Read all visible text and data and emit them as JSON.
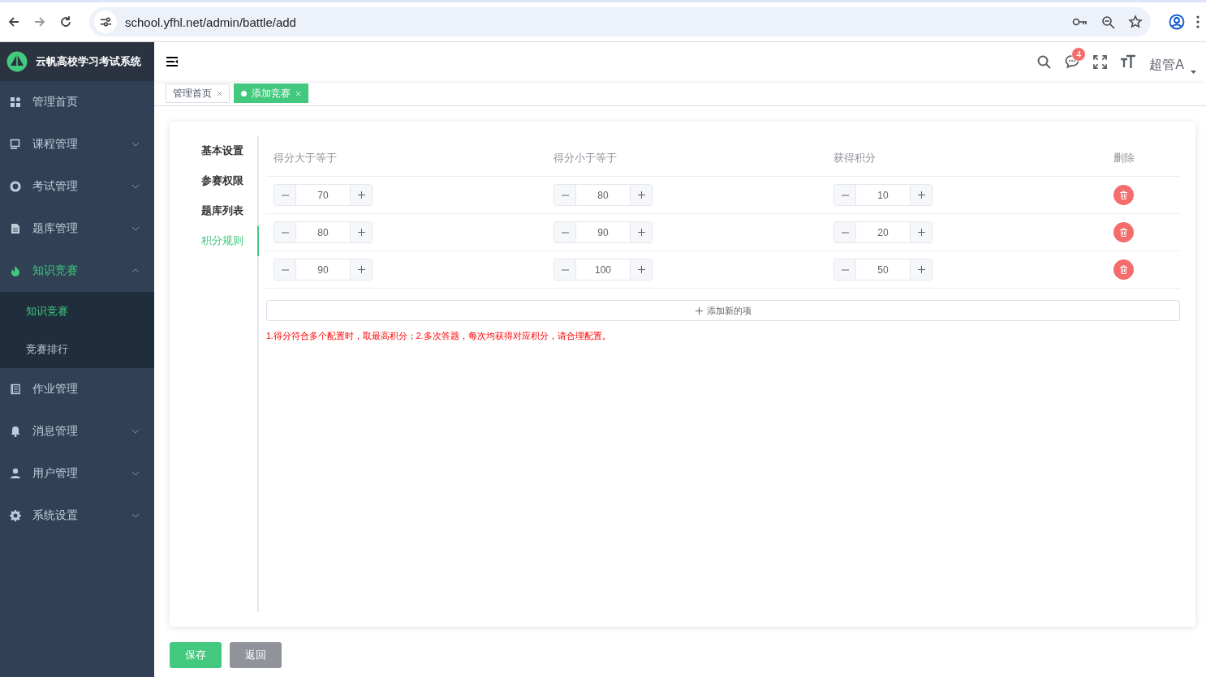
{
  "browser": {
    "url": "school.yfhl.net/admin/battle/add"
  },
  "sidebar": {
    "title": "云帆高校学习考试系统",
    "items": [
      {
        "label": "管理首页",
        "kind": "link",
        "selected": false
      },
      {
        "label": "课程管理",
        "kind": "submenu",
        "expanded": false,
        "selected": false
      },
      {
        "label": "考试管理",
        "kind": "submenu",
        "expanded": false,
        "selected": false
      },
      {
        "label": "题库管理",
        "kind": "submenu",
        "expanded": false,
        "selected": false
      },
      {
        "label": "知识竞赛",
        "kind": "submenu",
        "expanded": true,
        "selected": true,
        "children": [
          {
            "label": "知识竞赛",
            "selected": true
          },
          {
            "label": "竞赛排行",
            "selected": false
          }
        ]
      },
      {
        "label": "作业管理",
        "kind": "link",
        "selected": false
      },
      {
        "label": "消息管理",
        "kind": "submenu",
        "expanded": false,
        "selected": false
      },
      {
        "label": "用户管理",
        "kind": "submenu",
        "expanded": false,
        "selected": false
      },
      {
        "label": "系统设置",
        "kind": "submenu",
        "expanded": false,
        "selected": false
      }
    ]
  },
  "header": {
    "notification_count": "4",
    "user": "超管A"
  },
  "tabs": [
    {
      "label": "管理首页",
      "selected": false
    },
    {
      "label": "添加竞赛",
      "selected": true
    }
  ],
  "form_nav": [
    {
      "label": "基本设置",
      "selected": false
    },
    {
      "label": "参赛权限",
      "selected": false
    },
    {
      "label": "题库列表",
      "selected": false
    },
    {
      "label": "积分规则",
      "selected": true
    }
  ],
  "table": {
    "columns": [
      "得分大于等于",
      "得分小于等于",
      "获得积分",
      "删除"
    ],
    "rows": [
      {
        "min": "70",
        "max": "80",
        "points": "10"
      },
      {
        "min": "80",
        "max": "90",
        "points": "20"
      },
      {
        "min": "90",
        "max": "100",
        "points": "50"
      }
    ]
  },
  "add_button": "添加新的项",
  "note": "1.得分符合多个配置时，取最高积分；2.多次答题，每次均获得对应积分，请合理配置。",
  "buttons": [
    {
      "label": "保存",
      "kind": "primary"
    },
    {
      "label": "返回",
      "kind": "secondary"
    }
  ]
}
